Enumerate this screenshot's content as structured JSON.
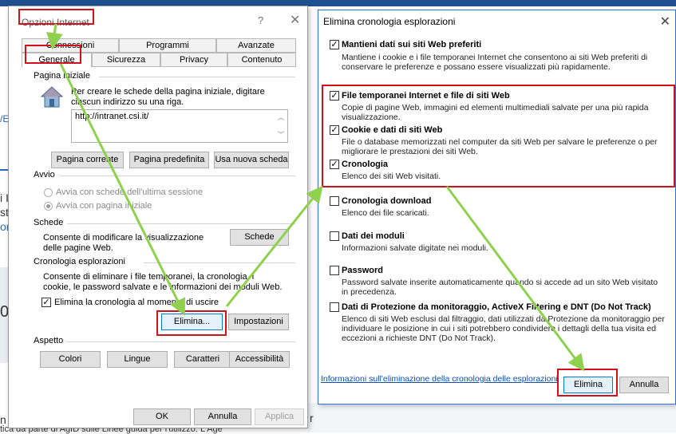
{
  "background": {
    "fragments": [
      "/E",
      "i I",
      "st",
      "on",
      "0",
      "n s",
      "r",
      "tica da parte di AgID sulle Linee guida per l'utilizzo. L'Age"
    ]
  },
  "internet_options": {
    "title": "Opzioni Internet",
    "help": "?",
    "close": "✕",
    "tabs_row1": [
      "Connessioni",
      "Programmi",
      "Avanzate"
    ],
    "tabs_row2": [
      "Generale",
      "Sicurezza",
      "Privacy",
      "Contenuto"
    ],
    "homepage": {
      "group": "Pagina iniziale",
      "instructions": "Per creare le schede della pagina iniziale, digitare ciascun indirizzo su una riga.",
      "url": "http://intranet.csi.it/",
      "buttons": [
        "Pagina corrente",
        "Pagina predefinita",
        "Usa nuova scheda"
      ]
    },
    "startup": {
      "group": "Avvio",
      "option1": "Avvia con schede dell'ultima sessione",
      "option2": "Avvia con pagina iniziale",
      "selected": "option2"
    },
    "tabs_section": {
      "group": "Schede",
      "text": "Consente di modificare la visualizzazione delle pagine Web.",
      "button": "Schede"
    },
    "history": {
      "group": "Cronologia esplorazioni",
      "text": "Consente di eliminare i file temporanei, la cronologia, i cookie, le password salvate e le informazioni dei moduli Web.",
      "checkbox": "Elimina la cronologia al momento di uscire",
      "checked": true,
      "delete_button": "Elimina...",
      "settings_button": "Impostazioni"
    },
    "appearance": {
      "group": "Aspetto",
      "buttons": [
        "Colori",
        "Lingue",
        "Caratteri",
        "Accessibilità"
      ]
    },
    "footer": {
      "ok": "OK",
      "cancel": "Annulla",
      "apply": "Applica"
    }
  },
  "delete_history": {
    "title": "Elimina cronologia esplorazioni",
    "close": "✕",
    "options": [
      {
        "title": "Mantieni dati sui siti Web preferiti",
        "desc": "Mantiene i cookie e i file temporanei Internet che consentono ai siti Web preferiti di conservare le preferenze e possano essere visualizzati più rapidamente.",
        "checked": true
      },
      {
        "title": "File temporanei Internet e file di siti Web",
        "desc": "Copie di pagine Web, immagini ed elementi multimediali salvate per una più rapida visualizzazione.",
        "checked": true
      },
      {
        "title": "Cookie e dati di siti Web",
        "desc": "File o database memorizzati nel computer da siti Web per salvare le preferenze o per migliorare le prestazioni dei siti Web.",
        "checked": true
      },
      {
        "title": "Cronologia",
        "desc": "Elenco dei siti Web visitati.",
        "checked": true
      },
      {
        "title": "Cronologia download",
        "desc": "Elenco dei file scaricati.",
        "checked": false
      },
      {
        "title": "Dati dei moduli",
        "desc": "Informazioni salvate digitate nei moduli.",
        "checked": false
      },
      {
        "title": "Password",
        "desc": "Password salvate inserite automaticamente quando si accede ad un sito Web visitato in precedenza.",
        "checked": false
      },
      {
        "title": "Dati di Protezione da monitoraggio, ActiveX Filtering e DNT (Do Not Track)",
        "desc": "Elenco di siti Web esclusi dal filtraggio, dati utilizzati da Protezione da monitoraggio per individuare le posizione in cui i siti potrebbero condividere i dettagli della tua visita ed eccezioni a richieste DNT (Do Not Track).",
        "checked": false
      }
    ],
    "link": "Informazioni sull'eliminazione della cronologia delle esplorazioni",
    "delete_button": "Elimina",
    "cancel_button": "Annulla"
  },
  "colors": {
    "highlight": "#d0101a",
    "arrow": "#8fd14f",
    "accent": "#0078d7"
  }
}
